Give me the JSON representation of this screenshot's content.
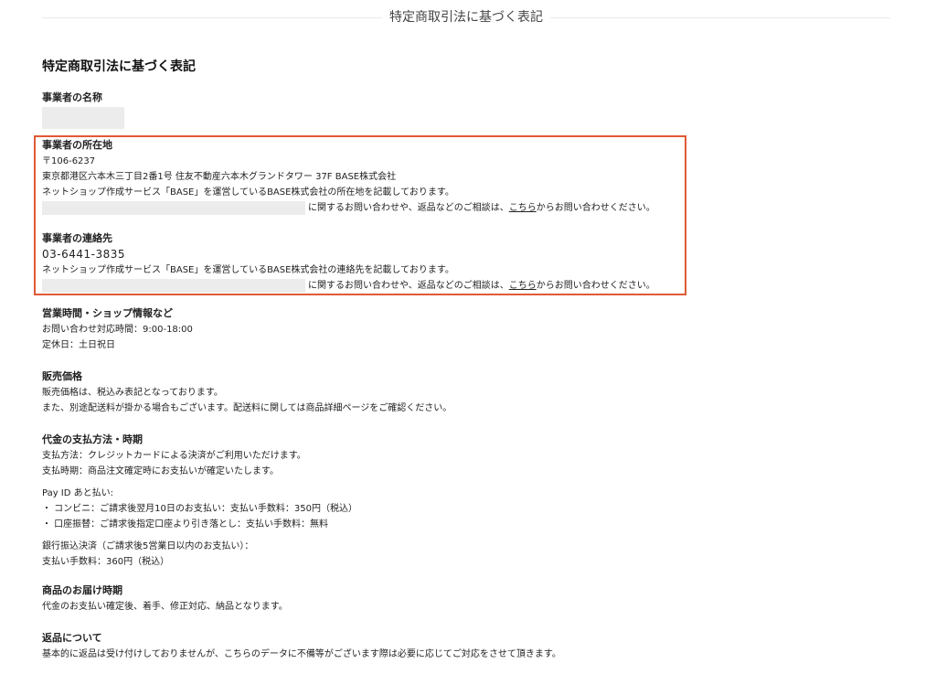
{
  "header": {
    "title": "特定商取引法に基づく表記"
  },
  "page_title": "特定商取引法に基づく表記",
  "sections": {
    "business_name": {
      "heading": "事業者の名称"
    },
    "address": {
      "heading": "事業者の所在地",
      "postal": "〒106-6237",
      "address": "東京都港区六本木三丁目2番1号 住友不動産六本木グランドタワー 37F BASE株式会社",
      "note": "ネットショップ作成サービス「BASE」を運営しているBASE株式会社の所在地を記載しております。",
      "contact_prefix": "に関するお問い合わせや、返品などのご相談は、",
      "contact_link": "こちら",
      "contact_suffix": "からお問い合わせください。"
    },
    "contact": {
      "heading": "事業者の連絡先",
      "phone": "03-6441-3835",
      "note": "ネットショップ作成サービス「BASE」を運営しているBASE株式会社の連絡先を記載しております。",
      "contact_prefix": "に関するお問い合わせや、返品などのご相談は、",
      "contact_link": "こちら",
      "contact_suffix": "からお問い合わせください。"
    },
    "hours": {
      "heading": "営業時間・ショップ情報など",
      "lines": [
        "お問い合わせ対応時間：9:00-18:00",
        "定休日：土日祝日"
      ]
    },
    "price": {
      "heading": "販売価格",
      "lines": [
        "販売価格は、税込み表記となっております。",
        "また、別途配送料が掛かる場合もございます。配送料に関しては商品詳細ページをご確認ください。"
      ]
    },
    "payment": {
      "heading": "代金の支払方法・時期",
      "lines": [
        "支払方法：クレジットカードによる決済がご利用いただけます。",
        "支払時期：商品注文確定時にお支払いが確定いたします。"
      ],
      "payid_lines": [
        "Pay ID あと払い:",
        "・ コンビニ：ご請求後翌月10日のお支払い：支払い手数料：350円（税込）",
        "・ 口座振替：ご請求後指定口座より引き落とし：支払い手数料：無料"
      ],
      "bank_lines": [
        "銀行振込決済（ご請求後5営業日以内のお支払い）：",
        "支払い手数料：360円（税込）"
      ]
    },
    "delivery": {
      "heading": "商品のお届け時期",
      "lines": [
        "代金のお支払い確定後、着手、修正対応、納品となります。"
      ]
    },
    "returns": {
      "heading": "返品について",
      "lines": [
        "基本的に返品は受け付けしておりませんが、こちらのデータに不備等がございます際は必要に応じてご対応をさせて頂きます。"
      ]
    }
  },
  "colors": {
    "highlight_border": "#e05a35",
    "redaction": "#ececec",
    "text": "#222222"
  }
}
